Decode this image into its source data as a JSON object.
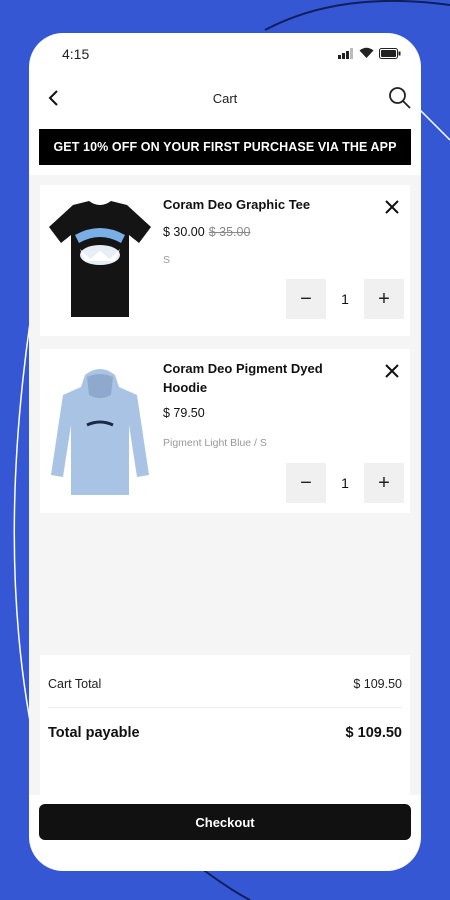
{
  "status_bar": {
    "time": "4:15"
  },
  "header": {
    "title": "Cart"
  },
  "promo": {
    "text": "GET 10% OFF ON YOUR FIRST PURCHASE VIA THE APP"
  },
  "cart_items": [
    {
      "name": "Coram Deo Graphic Tee",
      "price": "$ 30.00",
      "old_price": "$ 35.00",
      "variant": "S",
      "quantity": "1"
    },
    {
      "name": "Coram Deo Pigment Dyed Hoodie",
      "price": "$ 79.50",
      "variant": "Pigment Light Blue / S",
      "quantity": "1"
    }
  ],
  "quantity_controls": {
    "minus": "−",
    "plus": "+"
  },
  "totals": {
    "cart_total_label": "Cart Total",
    "cart_total_value": "$ 109.50",
    "payable_label": "Total payable",
    "payable_value": "$ 109.50"
  },
  "checkout": {
    "label": "Checkout"
  },
  "colors": {
    "background": "#3557d4",
    "accent": "#000000"
  }
}
